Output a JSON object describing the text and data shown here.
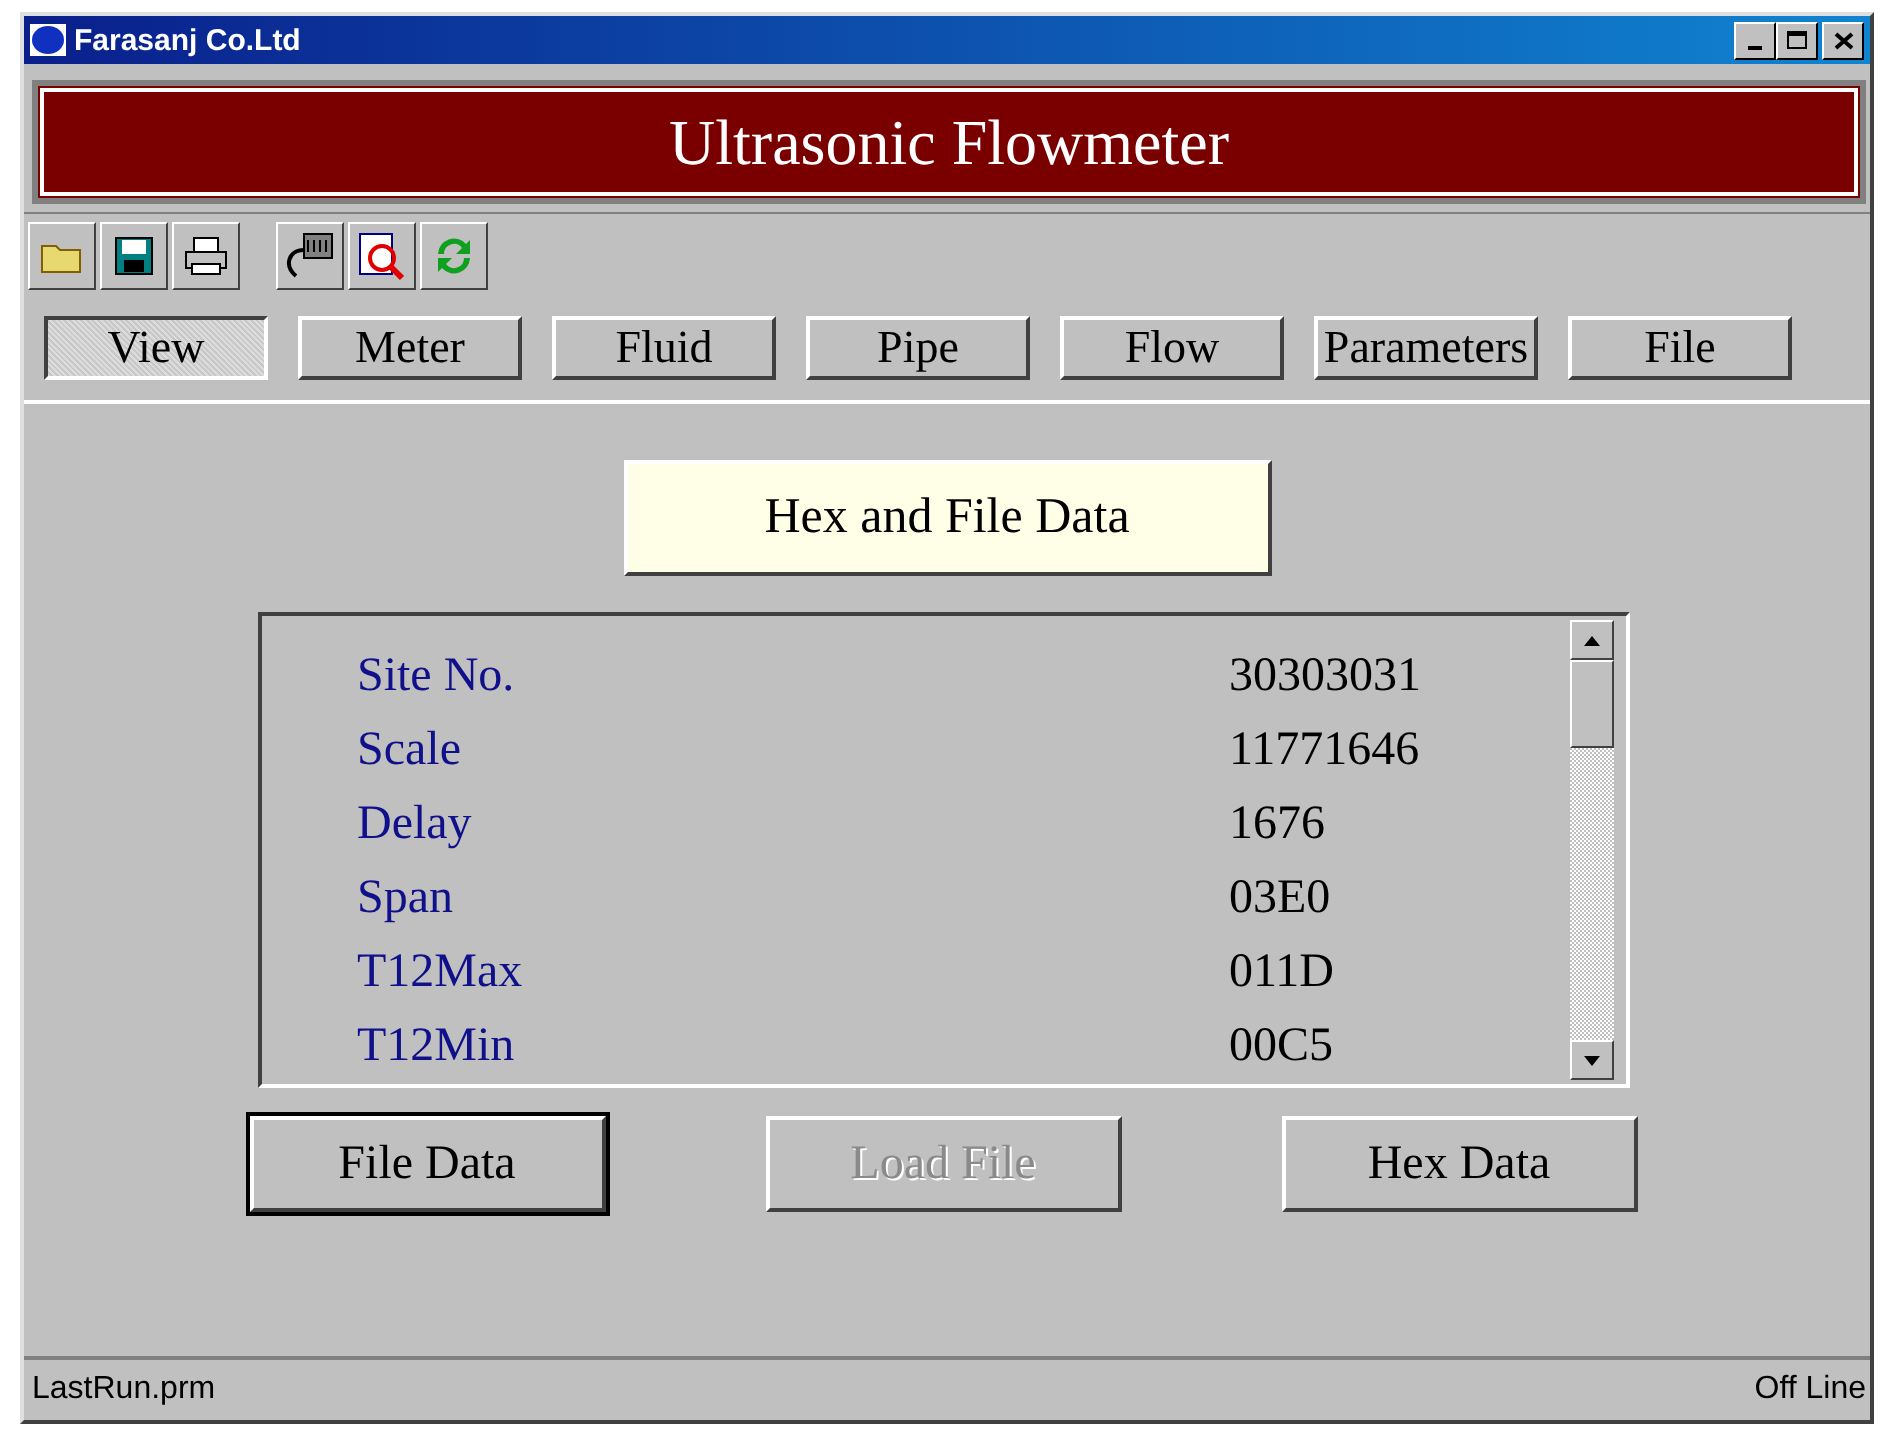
{
  "window": {
    "title": "Farasanj Co.Ltd"
  },
  "banner": "Ultrasonic Flowmeter",
  "tabs": [
    {
      "label": "View",
      "selected": true
    },
    {
      "label": "Meter",
      "selected": false
    },
    {
      "label": "Fluid",
      "selected": false
    },
    {
      "label": "Pipe",
      "selected": false
    },
    {
      "label": "Flow",
      "selected": false
    },
    {
      "label": "Parameters",
      "selected": false
    },
    {
      "label": "File",
      "selected": false
    }
  ],
  "panel_title": "Hex and File Data",
  "rows": [
    {
      "name": "Site No.",
      "value": "30303031"
    },
    {
      "name": "Scale",
      "value": "11771646"
    },
    {
      "name": "Delay",
      "value": "1676"
    },
    {
      "name": "Span",
      "value": "03E0"
    },
    {
      "name": "T12Max",
      "value": "011D"
    },
    {
      "name": "T12Min",
      "value": "00C5"
    }
  ],
  "buttons": [
    {
      "label": "File Data",
      "disabled": false,
      "focused": true
    },
    {
      "label": "Load File",
      "disabled": true,
      "focused": false
    },
    {
      "label": "Hex Data",
      "disabled": false,
      "focused": false
    }
  ],
  "status_bar": {
    "left": "LastRun.prm",
    "right": "Off Line"
  }
}
